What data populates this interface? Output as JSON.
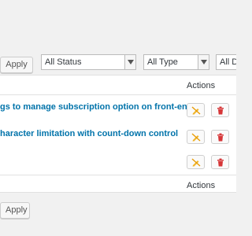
{
  "top_bar": {
    "apply_label": "Apply"
  },
  "filters": {
    "status": {
      "value": "All Status"
    },
    "type": {
      "value": "All Type"
    },
    "date": {
      "value": "All Da"
    }
  },
  "table": {
    "header_actions": "Actions",
    "footer_actions": "Actions",
    "rows": [
      {
        "title": "gs to manage subscription option on front-end"
      },
      {
        "title": "haracter limitation with count-down control"
      },
      {
        "title": ""
      }
    ]
  },
  "bottom_bar": {
    "apply_label": "Apply"
  },
  "icons": {
    "edit": "pen-off-icon",
    "delete": "trash-icon",
    "edit_color": "#f0b429",
    "delete_color": "#d63638"
  }
}
